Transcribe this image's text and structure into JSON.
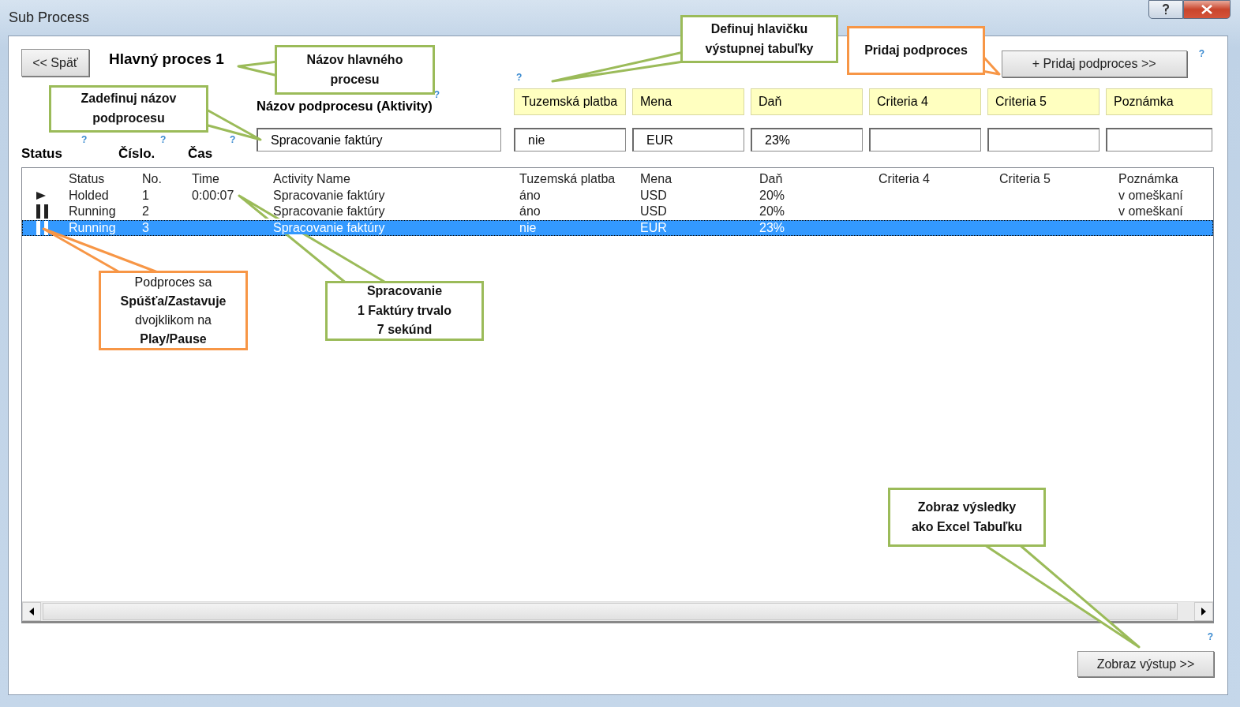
{
  "window": {
    "title": "Sub Process"
  },
  "header": {
    "back_button": "<< Späť",
    "process_name": "Hlavný proces 1",
    "add_button": "+ Pridaj podproces >>",
    "add_help": "?"
  },
  "activity": {
    "label": "Názov podprocesu (Aktivity)",
    "help": "?",
    "value": "Spracovanie faktúry"
  },
  "criteria": {
    "help": "?",
    "columns": [
      {
        "header": "Tuzemská platba",
        "value": "nie"
      },
      {
        "header": "Mena",
        "value": "EUR"
      },
      {
        "header": "Daň",
        "value": "23%"
      },
      {
        "header": "Criteria 4"
      },
      {
        "header": "Criteria 5"
      },
      {
        "header": "Poznámka"
      }
    ]
  },
  "list_labels": [
    {
      "label": "Status",
      "help": "?"
    },
    {
      "label": "Číslo.",
      "help": "?"
    },
    {
      "label": "Čas",
      "help": "?"
    }
  ],
  "list": {
    "columns": [
      "Status",
      "No.",
      "Time",
      "Activity Name",
      "Tuzemská platba",
      "Mena",
      "Daň",
      "Criteria 4",
      "Criteria 5",
      "Poznámka"
    ],
    "rows": [
      {
        "kind": "play",
        "selected": false,
        "status": "Holded",
        "no": "1",
        "time": "0:00:07",
        "activity": "Spracovanie faktúry",
        "tuzemska_platba": "áno",
        "mena": "USD",
        "dan": "20%",
        "poznamka": "v omeškaní"
      },
      {
        "kind": "pause",
        "selected": false,
        "status": "Running",
        "no": "2",
        "activity": "Spracovanie faktúry",
        "tuzemska_platba": "áno",
        "mena": "USD",
        "dan": "20%",
        "poznamka": "v omeškaní"
      },
      {
        "kind": "pause",
        "selected": true,
        "status": "Running",
        "no": "3",
        "activity": "Spracovanie faktúry",
        "tuzemska_platba": "nie",
        "mena": "EUR",
        "dan": "23%"
      }
    ]
  },
  "footer": {
    "help": "?",
    "output_button": "Zobraz výstup >>"
  },
  "callouts": [
    {
      "text": "Názov hlavného\nprocesu",
      "color": "#9bbb59"
    },
    {
      "text": "Zadefinuj názov\npodprocesu",
      "color": "#9bbb59"
    },
    {
      "text": "Definuj hlavičku\nvýstupnej tabuľky",
      "color": "#9bbb59"
    },
    {
      "text": "Pridaj podproces",
      "color": "#f79646"
    },
    {
      "text": "Podproces sa\n**Spúšťa/Zastavuje**\ndvojklikom na\n**Play/Pause**",
      "color": "#f79646",
      "bold": false
    },
    {
      "text": "Spracovanie\n1 Faktúry trvalo\n7 sekúnd",
      "color": "#9bbb59"
    },
    {
      "text": "Zobraz výsledky\nako Excel Tabuľku",
      "color": "#9bbb59"
    }
  ]
}
